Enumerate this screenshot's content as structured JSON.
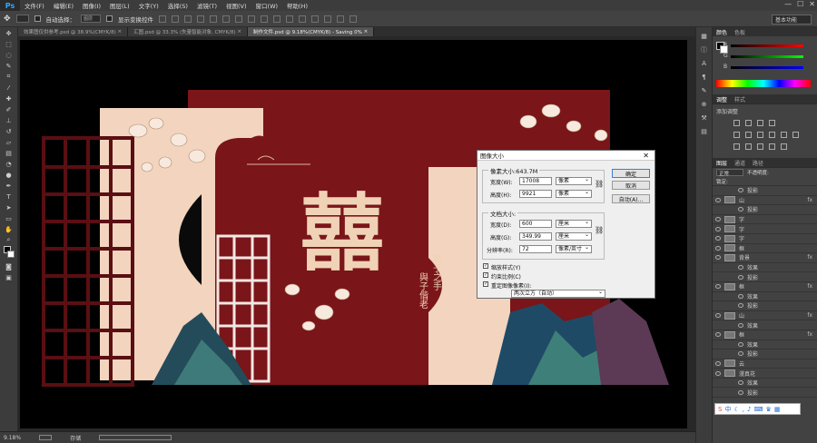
{
  "app": {
    "logo": "Ps"
  },
  "menu": [
    "文件(F)",
    "编辑(E)",
    "图像(I)",
    "图层(L)",
    "文字(Y)",
    "选择(S)",
    "滤镜(T)",
    "视图(V)",
    "窗口(W)",
    "帮助(H)"
  ],
  "window_controls": [
    "—",
    "☐",
    "✕"
  ],
  "options": {
    "auto_select_label": "自动选择：",
    "auto_select_value": "图层",
    "transform_label": "显示变换控件",
    "workspace": "基本功能"
  },
  "tabs": [
    {
      "label": "效果图仅供参考.psd @ 38.9%(CMYK/8)",
      "close": "×"
    },
    {
      "label": "汇图.psd @ 33.3% (失量智能对象, CMYK/8)",
      "close": "×"
    },
    {
      "label": "制作文件.psd @ 9.18%(CMYK/8) - Saving 0%",
      "close": "×"
    }
  ],
  "status": {
    "zoom": "9.18%",
    "save_label": "存储",
    "progress_pct": 0,
    "progress_text": "0%"
  },
  "artwork": {
    "main_char": "囍",
    "poem_line1": "執子之手",
    "poem_line2": "與子偕老"
  },
  "panels": {
    "color_tabs": [
      "颜色",
      "色板"
    ],
    "rgb_labels": [
      "R",
      "G",
      "B"
    ],
    "adjust_tabs": [
      "调整",
      "样式"
    ],
    "adjust_title": "添加调整",
    "layer_tabs": [
      "图层",
      "通道",
      "路径"
    ],
    "blend_mode": "正常",
    "opacity_label": "不透明度:",
    "lock_label": "锁定:",
    "layers": [
      {
        "name": "投影",
        "sub": true,
        "fx": false
      },
      {
        "name": "山",
        "sub": false,
        "fx": true
      },
      {
        "name": "投影",
        "sub": true,
        "fx": false
      },
      {
        "name": "字",
        "sub": false,
        "fx": false
      },
      {
        "name": "字",
        "sub": false,
        "fx": false
      },
      {
        "name": "字",
        "sub": false,
        "fx": false
      },
      {
        "name": "框",
        "sub": false,
        "fx": false
      },
      {
        "name": "背景",
        "sub": false,
        "fx": true
      },
      {
        "name": "效果",
        "sub": true,
        "fx": false
      },
      {
        "name": "投影",
        "sub": true,
        "fx": false
      },
      {
        "name": "框",
        "sub": false,
        "fx": true
      },
      {
        "name": "效果",
        "sub": true,
        "fx": false
      },
      {
        "name": "投影",
        "sub": true,
        "fx": false
      },
      {
        "name": "山",
        "sub": false,
        "fx": true
      },
      {
        "name": "效果",
        "sub": true,
        "fx": false
      },
      {
        "name": "框",
        "sub": false,
        "fx": true
      },
      {
        "name": "效果",
        "sub": true,
        "fx": false
      },
      {
        "name": "投影",
        "sub": true,
        "fx": false
      },
      {
        "name": "云",
        "sub": false,
        "fx": false
      },
      {
        "name": "漫真花",
        "sub": false,
        "fx": false
      },
      {
        "name": "效果",
        "sub": true,
        "fx": false
      },
      {
        "name": "投影",
        "sub": true,
        "fx": false
      }
    ]
  },
  "dialog": {
    "title": "图像大小",
    "close": "✕",
    "pixel_dims_label": "像素大小:643.7M",
    "width_label": "宽度(W):",
    "width_value": "17008",
    "width_unit": "像素",
    "height_label": "高度(H):",
    "height_value": "9921",
    "height_unit": "像素",
    "doc_size_label": "文档大小:",
    "doc_width_label": "宽度(D):",
    "doc_width_value": "600",
    "doc_width_unit": "厘米",
    "doc_height_label": "高度(G):",
    "doc_height_value": "349.99",
    "doc_height_unit": "厘米",
    "resolution_label": "分辨率(R):",
    "resolution_value": "72",
    "resolution_unit": "像素/英寸",
    "scale_styles": "缩放样式(Y)",
    "constrain": "约束比例(C)",
    "resample": "重定图像像素(I):",
    "resample_method": "两次立方（自动）",
    "ok": "确定",
    "cancel": "取消",
    "auto": "自动(A)..."
  },
  "ime": {
    "label": "中"
  }
}
